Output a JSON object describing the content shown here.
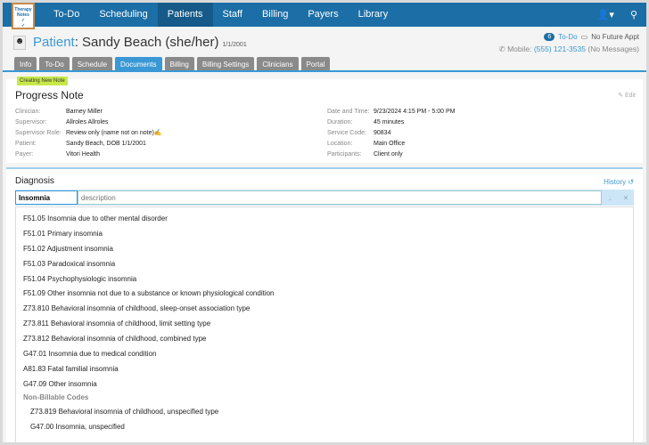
{
  "nav": {
    "logo": "Therapy Notes",
    "items": [
      "To-Do",
      "Scheduling",
      "Patients",
      "Staff",
      "Billing",
      "Payers",
      "Library"
    ],
    "active": "Patients"
  },
  "patient": {
    "label": "Patient",
    "name": ": Sandy Beach (she/her)",
    "dob": "1/1/2001",
    "todo_count": "6",
    "todo_label": "To-Do",
    "appt": "No Future Appt",
    "mobile_label": "Mobile:",
    "phone": "(555) 121-3535",
    "messages": "(No Messages)"
  },
  "tabs": [
    "Info",
    "To-Do",
    "Schedule",
    "Documents",
    "Billing",
    "Billing Settings",
    "Clinicians",
    "Portal"
  ],
  "active_tab": "Documents",
  "note": {
    "status": "Creating New Note",
    "title": "Progress Note",
    "edit": "Edit",
    "left": [
      [
        "Clinician:",
        "Barney Miller"
      ],
      [
        "Supervisor:",
        "Allroles Allroles"
      ],
      [
        "Supervisor Role:",
        "Review only (name not on note)"
      ],
      [
        "Patient:",
        "Sandy Beach, DOB 1/1/2001"
      ],
      [
        "Payer:",
        "Vitori Health"
      ]
    ],
    "right": [
      [
        "Date and Time:",
        "9/23/2024 4:15 PM - 5:00 PM"
      ],
      [
        "Duration:",
        "45 minutes"
      ],
      [
        "Service Code:",
        "90834"
      ],
      [
        "Location:",
        "Main Office"
      ],
      [
        "Participants:",
        "Client only"
      ]
    ]
  },
  "diagnosis": {
    "title": "Diagnosis",
    "history": "History",
    "query": "Insomnia",
    "placeholder": "description",
    "results": [
      "F51.05 Insomnia due to other mental disorder",
      "F51.01 Primary insomnia",
      "F51.02 Adjustment insomnia",
      "F51.03 Paradoxical insomnia",
      "F51.04 Psychophysiologic insomnia",
      "F51.09 Other insomnia not due to a substance or known physiological condition",
      "Z73.810 Behavioral insomnia of childhood, sleep-onset association type",
      "Z73.811 Behavioral insomnia of childhood, limit setting type",
      "Z73.812 Behavioral insomnia of childhood, combined type",
      "G47.01 Insomnia due to medical condition",
      "A81.83 Fatal familial insomnia",
      "G47.09 Other insomnia"
    ],
    "group": "Non-Billable Codes",
    "group_results": [
      "Z73.819 Behavioral insomnia of childhood, unspecified type",
      "G47.00 Insomnia, unspecified"
    ]
  }
}
